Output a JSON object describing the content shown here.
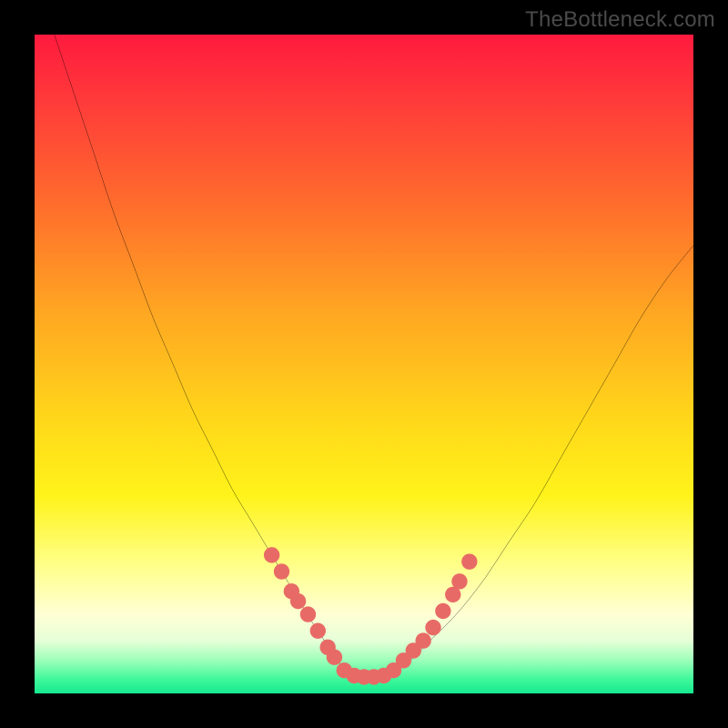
{
  "watermark": "TheBottleneck.com",
  "chart_data": {
    "type": "line",
    "title": "",
    "xlabel": "",
    "ylabel": "",
    "xlim": [
      0,
      100
    ],
    "ylim": [
      0,
      100
    ],
    "grid": false,
    "gradient_stops": [
      {
        "pos": 0,
        "color": "#ff1a3e"
      },
      {
        "pos": 10,
        "color": "#ff3a3a"
      },
      {
        "pos": 25,
        "color": "#ff6a2d"
      },
      {
        "pos": 42,
        "color": "#ffa622"
      },
      {
        "pos": 58,
        "color": "#ffd61a"
      },
      {
        "pos": 70,
        "color": "#fff31a"
      },
      {
        "pos": 80,
        "color": "#ffff84"
      },
      {
        "pos": 88,
        "color": "#ffffd4"
      },
      {
        "pos": 92,
        "color": "#e6ffd7"
      },
      {
        "pos": 95,
        "color": "#9cffb9"
      },
      {
        "pos": 98,
        "color": "#3cf79a"
      },
      {
        "pos": 100,
        "color": "#16e98f"
      }
    ],
    "series": [
      {
        "name": "curve",
        "color": "#000000",
        "x": [
          3,
          6,
          9,
          12,
          15,
          18,
          21,
          24,
          27,
          30,
          33,
          36,
          39,
          42,
          44,
          46,
          48,
          50,
          52,
          54,
          57,
          60,
          64,
          68,
          72,
          76,
          80,
          84,
          88,
          92,
          96,
          100
        ],
        "y": [
          100,
          91,
          82,
          73,
          65,
          57,
          50,
          43,
          37,
          31,
          26,
          21,
          16,
          11,
          8,
          5,
          3,
          2.5,
          2.5,
          3,
          5,
          8,
          12,
          17,
          23,
          29,
          36,
          43,
          50,
          57,
          63,
          68
        ]
      }
    ],
    "markers": {
      "name": "dots",
      "color": "#e86a66",
      "radius": 1.2,
      "points": [
        {
          "x": 36.0,
          "y": 21.0
        },
        {
          "x": 37.5,
          "y": 18.5
        },
        {
          "x": 39.0,
          "y": 15.5
        },
        {
          "x": 40.0,
          "y": 14.0
        },
        {
          "x": 41.5,
          "y": 12.0
        },
        {
          "x": 43.0,
          "y": 9.5
        },
        {
          "x": 44.5,
          "y": 7.0
        },
        {
          "x": 45.5,
          "y": 5.5
        },
        {
          "x": 47.0,
          "y": 3.5
        },
        {
          "x": 48.5,
          "y": 2.7
        },
        {
          "x": 50.0,
          "y": 2.5
        },
        {
          "x": 51.5,
          "y": 2.5
        },
        {
          "x": 53.0,
          "y": 2.7
        },
        {
          "x": 54.5,
          "y": 3.5
        },
        {
          "x": 56.0,
          "y": 5.0
        },
        {
          "x": 57.5,
          "y": 6.5
        },
        {
          "x": 59.0,
          "y": 8.0
        },
        {
          "x": 60.5,
          "y": 10.0
        },
        {
          "x": 62.0,
          "y": 12.5
        },
        {
          "x": 63.5,
          "y": 15.0
        },
        {
          "x": 64.5,
          "y": 17.0
        },
        {
          "x": 66.0,
          "y": 20.0
        }
      ]
    }
  }
}
